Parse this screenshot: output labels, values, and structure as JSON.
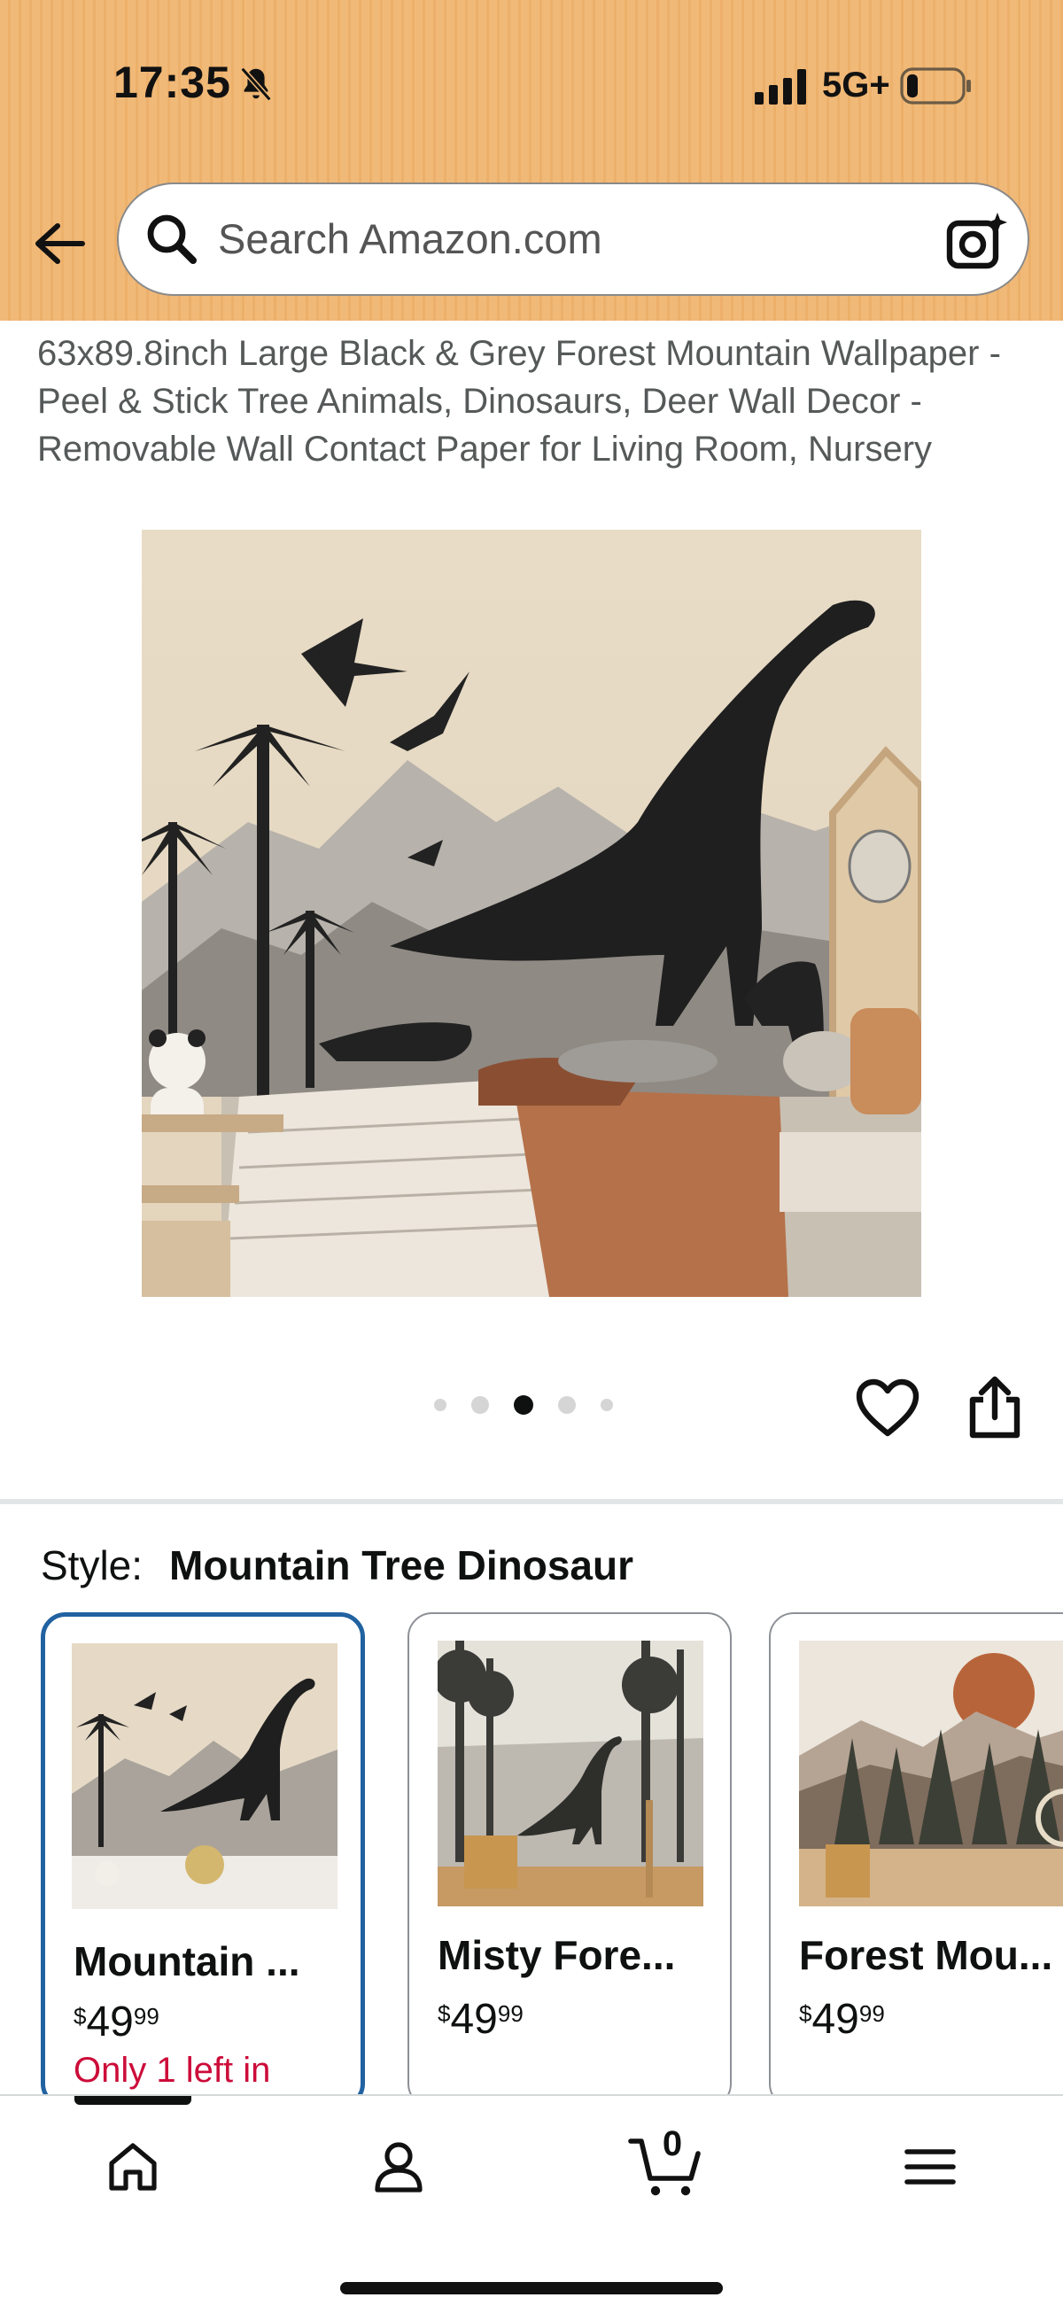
{
  "status_bar": {
    "time": "17:35",
    "network": "5G+",
    "icons": [
      "bell-slash-icon",
      "signal-bars-icon",
      "battery-icon"
    ]
  },
  "header": {
    "search_placeholder": "Search Amazon.com",
    "icons": [
      "back-arrow-icon",
      "search-icon",
      "camera-icon"
    ],
    "background_color": "#f1b977"
  },
  "product": {
    "title": "63x89.8inch Large Black & Grey Forest Mountain Wallpaper - Peel & Stick Tree Animals, Dinosaurs, Deer Wall Decor - Removable Wall Contact Paper for Living Room, Nursery",
    "image_count": 5,
    "active_image_index": 2
  },
  "style": {
    "label": "Style:",
    "selected_value": "Mountain Tree Dinosaur",
    "options": [
      {
        "name": "Mountain ...",
        "price_dollars": "49",
        "price_cents": "99",
        "stock": "Only 1 left in",
        "selected": true
      },
      {
        "name": "Misty Fore...",
        "price_dollars": "49",
        "price_cents": "99",
        "stock": "",
        "selected": false
      },
      {
        "name": "Forest Mou...",
        "price_dollars": "49",
        "price_cents": "99",
        "stock": "",
        "selected": false
      }
    ],
    "currency_symbol": "$"
  },
  "bottom_nav": {
    "items": [
      "home-icon",
      "account-icon",
      "cart-icon",
      "menu-icon"
    ],
    "cart_count": "0"
  },
  "colors": {
    "accent_selected": "#2162a1",
    "stock_warning": "#cc0c39"
  }
}
